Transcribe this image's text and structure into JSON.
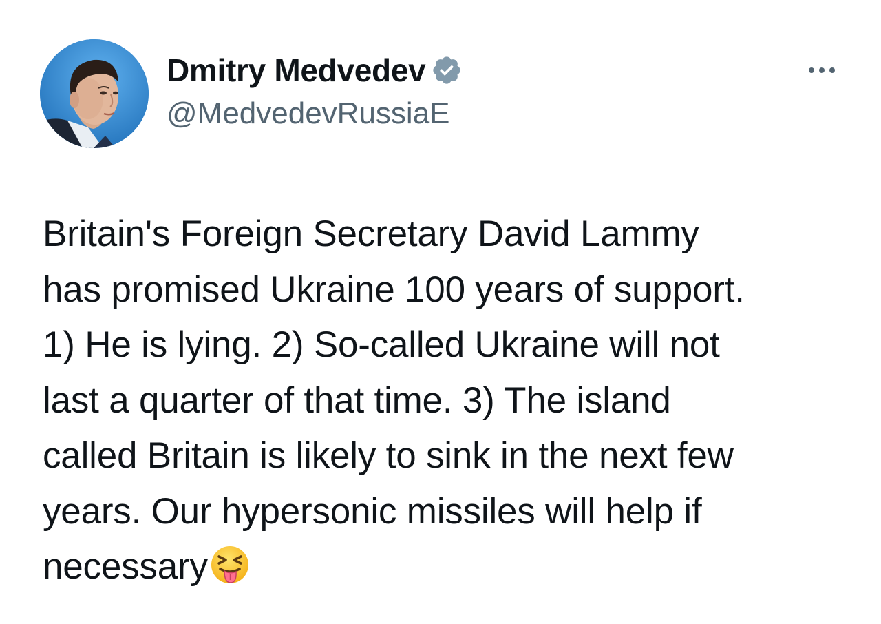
{
  "author": {
    "display_name": "Dmitry Medvedev",
    "handle": "@MedvedevRussiaE",
    "verified": true,
    "avatar_icon": "profile-photo-icon"
  },
  "menu": {
    "icon": "more-options-icon"
  },
  "tweet": {
    "lines": [
      "Britain's Foreign Secretary David Lammy",
      "has promised Ukraine 100 years of support.",
      "1) He is lying. 2) So-called Ukraine will not",
      "last a quarter of that time. 3) The island",
      "called Britain is likely to sink in the next few",
      "years. Our hypersonic missiles will help if",
      "necessary"
    ],
    "trailing_emoji": "squinting-face-with-tongue-icon"
  },
  "colors": {
    "text_primary": "#0f1419",
    "text_secondary": "#536471",
    "verified_badge": "#829aab",
    "background": "#ffffff",
    "avatar_bg": "#3b8fd6"
  }
}
